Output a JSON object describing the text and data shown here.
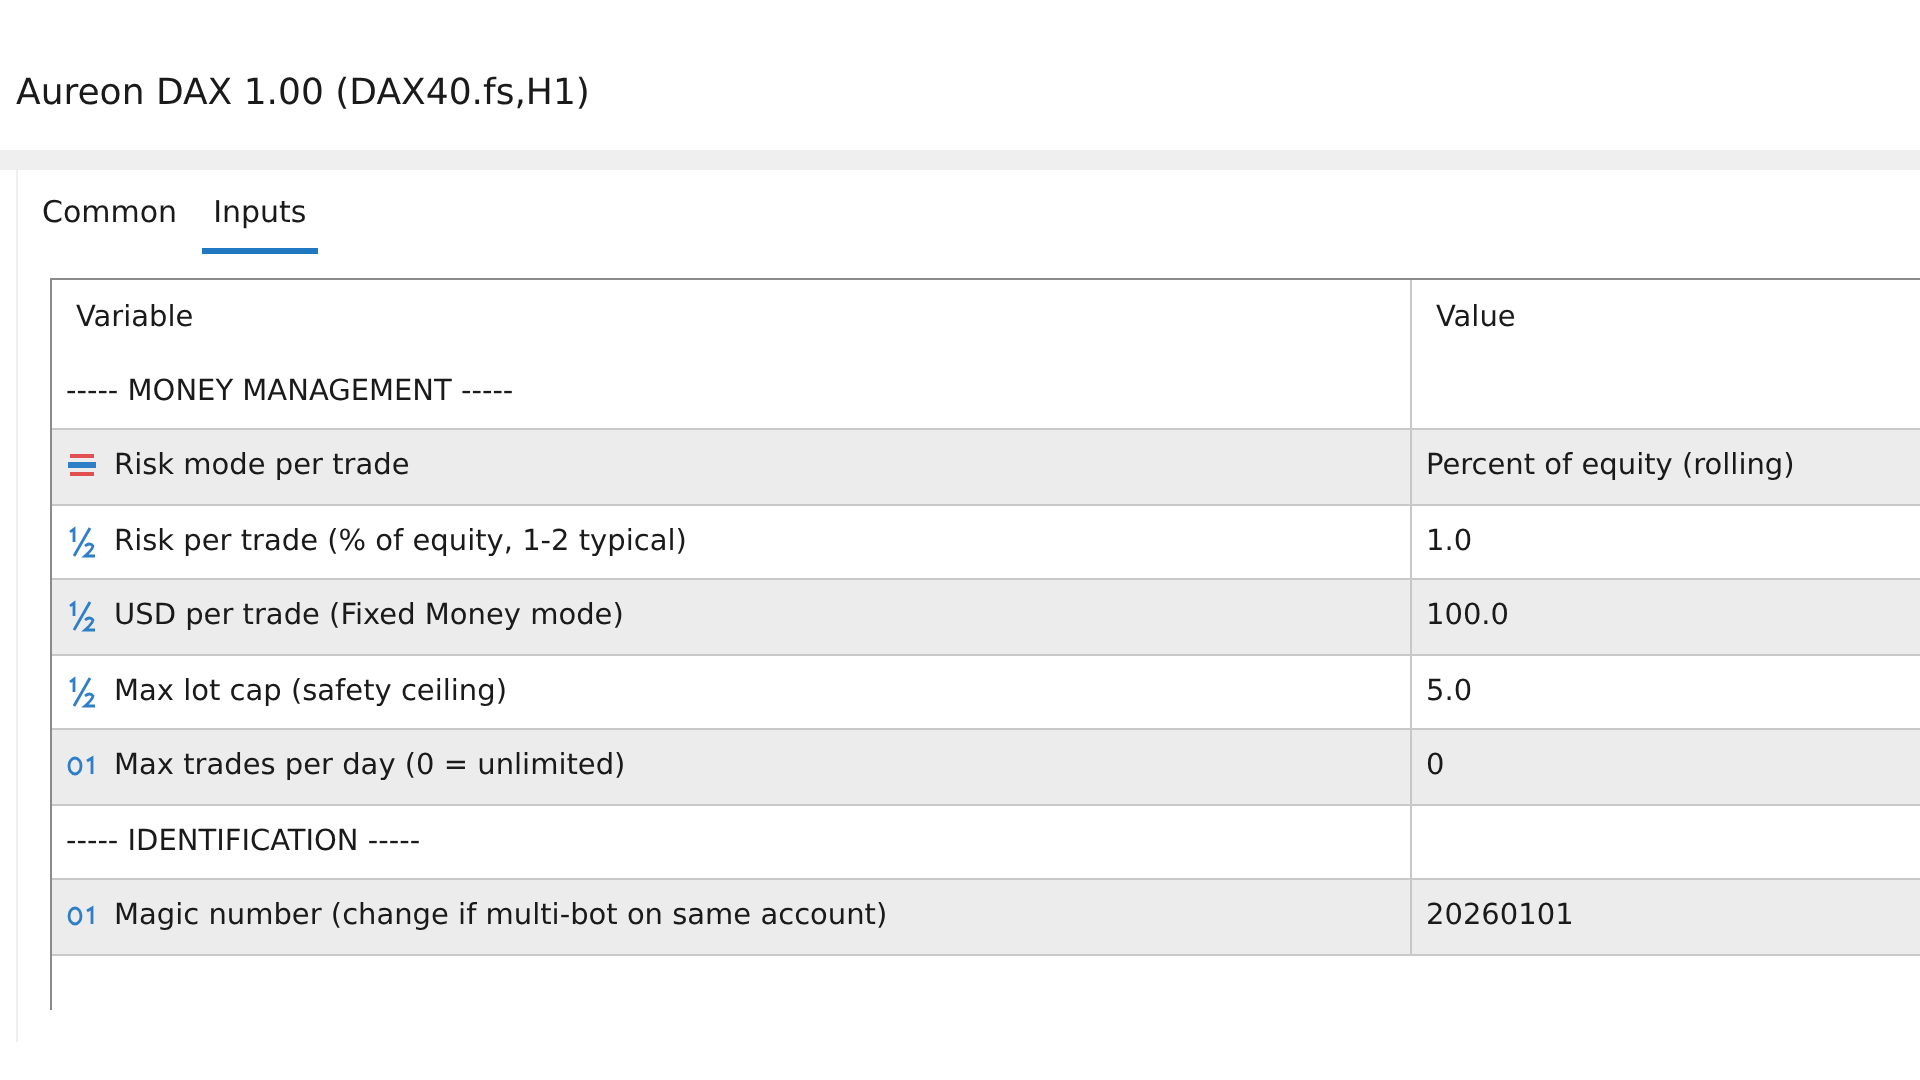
{
  "window": {
    "title": "Aureon DAX 1.00 (DAX40.fs,H1)"
  },
  "tabs": [
    {
      "label": "Common",
      "selected": false
    },
    {
      "label": "Inputs",
      "selected": true
    }
  ],
  "table": {
    "columns": [
      "Variable",
      "Value"
    ],
    "rows": [
      {
        "kind": "section",
        "variable": "----- MONEY MANAGEMENT -----"
      },
      {
        "kind": "enum",
        "variable": "Risk mode per trade",
        "value": "Percent of equity (rolling)"
      },
      {
        "kind": "double",
        "variable": "Risk per trade (% of equity, 1-2 typical)",
        "value": "1.0"
      },
      {
        "kind": "double",
        "variable": "USD per trade (Fixed Money mode)",
        "value": "100.0"
      },
      {
        "kind": "double",
        "variable": "Max lot cap (safety ceiling)",
        "value": "5.0"
      },
      {
        "kind": "int",
        "variable": "Max trades per day (0 = unlimited)",
        "value": "0"
      },
      {
        "kind": "section",
        "variable": "----- IDENTIFICATION -----"
      },
      {
        "kind": "int",
        "variable": "Magic number (change if multi-bot on same account)",
        "value": "20260101"
      }
    ]
  }
}
